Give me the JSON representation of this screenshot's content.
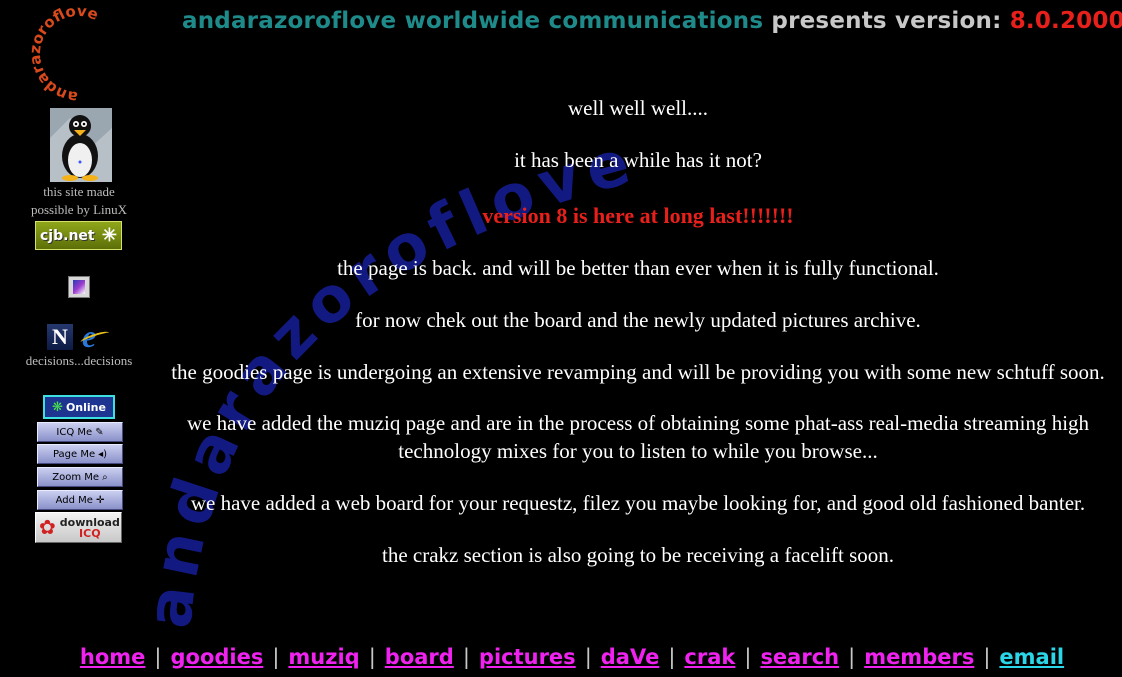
{
  "header": {
    "part1": "andarazoroflove worldwide communications",
    "part2": "presents version:",
    "version": "8.0.2000"
  },
  "watermark_text": "andarazoroflove",
  "logo_text": "andarazoroflove",
  "sidebar": {
    "linux_caption_1": "this site made",
    "linux_caption_2": "possible by LinuX",
    "cjb_label": "cjb.net",
    "browsers_caption": "decisions...decisions",
    "icq": {
      "online": "Online",
      "icq_me": "ICQ Me",
      "page_me": "Page Me",
      "zoom_me": "Zoom Me",
      "add_me": "Add Me",
      "download": "download",
      "download_icq": "ICQ"
    }
  },
  "content": {
    "p1": "well well well....",
    "p2": "it has been a while has it not?",
    "p3": "version 8 is here at long last!!!!!!!",
    "p4": "the page is back. and will be better than ever when it is fully functional.",
    "p5": "for now chek out the board and the newly updated pictures archive.",
    "p6": "the goodies page is undergoing an extensive revamping and will be providing you with some new schtuff soon.",
    "p7": "we have added the muziq page and are in the process of obtaining some phat-ass real-media streaming high technology mixes for you to listen to while you browse...",
    "p8": "we have added a web board for your requestz, filez you maybe looking for, and good old fashioned banter.",
    "p9": "the crakz section is also going to be receiving a facelift soon."
  },
  "nav": [
    "home",
    "goodies",
    "muziq",
    "board",
    "pictures",
    "daVe",
    "crak",
    "search",
    "members",
    "email"
  ],
  "colors": {
    "background": "#000000",
    "header_teal": "#1f8a8a",
    "header_grey": "#c8c8c8",
    "accent_red": "#e8201c",
    "nav_magenta": "#f022f0",
    "nav_email_cyan": "#2ad6e8",
    "watermark_blue": "#141c8a"
  },
  "icons": [
    "andarazoroflove-logo",
    "linux-penguin-icon",
    "cjb-net-badge",
    "small-image-icon",
    "netscape-icon",
    "ie-icon",
    "icq-flower-icon"
  ]
}
